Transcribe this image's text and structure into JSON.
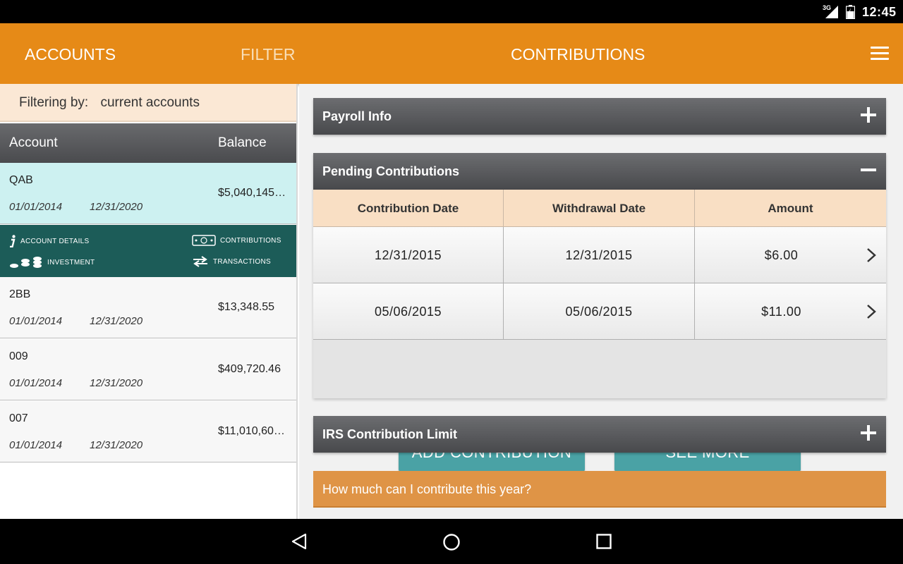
{
  "status_bar": {
    "network": "3G",
    "time": "12:45"
  },
  "app_bar": {
    "tabs": [
      {
        "label": "ACCOUNTS"
      },
      {
        "label": "FILTER"
      },
      {
        "label": "CONTRIBUTIONS"
      }
    ],
    "menu_icon": "hamburger-menu-icon"
  },
  "filter": {
    "label": "Filtering by:",
    "value": "current accounts"
  },
  "accounts_table": {
    "headers": {
      "account": "Account",
      "balance": "Balance"
    },
    "rows": [
      {
        "name": "QAB",
        "start_date": "01/01/2014",
        "end_date": "12/31/2020",
        "balance": "$5,040,145…"
      },
      {
        "name": "2BB",
        "start_date": "01/01/2014",
        "end_date": "12/31/2020",
        "balance": "$13,348.55"
      },
      {
        "name": "009",
        "start_date": "01/01/2014",
        "end_date": "12/31/2020",
        "balance": "$409,720.46"
      },
      {
        "name": "007",
        "start_date": "01/01/2014",
        "end_date": "12/31/2020",
        "balance": "$11,010,60…"
      }
    ]
  },
  "account_actions": {
    "details": "ACCOUNT DETAILS",
    "contributions": "CONTRIBUTIONS",
    "investment": "INVESTMENT",
    "transactions": "TRANSACTIONS"
  },
  "panels": {
    "payroll": {
      "title": "Payroll Info"
    },
    "pending": {
      "title": "Pending Contributions",
      "headers": [
        "Contribution Date",
        "Withdrawal Date",
        "Amount"
      ],
      "rows": [
        {
          "contribution_date": "12/31/2015",
          "withdrawal_date": "12/31/2015",
          "amount": "$6.00"
        },
        {
          "contribution_date": "05/06/2015",
          "withdrawal_date": "05/06/2015",
          "amount": "$11.00"
        }
      ],
      "add_button": "ADD CONTRIBUTION",
      "see_more_button": "SEE MORE"
    },
    "irs": {
      "title": "IRS Contribution Limit"
    },
    "faq": {
      "text": "How much can I contribute this year?"
    }
  },
  "colors": {
    "app_bar": "#e68a17",
    "selected_row": "#cdf1f1",
    "action_bar": "#1c5c58",
    "button": "#4aa2a5",
    "table_header": "#f9dfc4",
    "faq_bar": "#df9446"
  }
}
